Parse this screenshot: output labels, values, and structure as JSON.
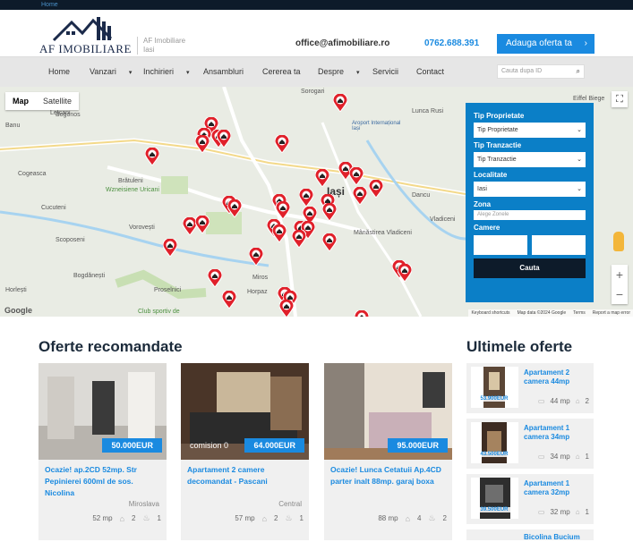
{
  "topbar": {
    "breadcrumb": "Home"
  },
  "header": {
    "logo_text": "AF IMOBILIARE",
    "tagline_line1": "AF Imobiliare",
    "tagline_line2": "Iasi",
    "email": "office@afimobiliare.ro",
    "phone": "0762.688.391",
    "add_offer_label": "Adauga oferta ta"
  },
  "nav": {
    "items": [
      "Home",
      "Vanzari",
      "Inchirieri",
      "Ansambluri",
      "Cererea ta",
      "Despre",
      "Servicii",
      "Contact"
    ],
    "search_placeholder": "Cauta dupa ID"
  },
  "map": {
    "type_map": "Map",
    "type_satellite": "Satellite",
    "google_label": "Google",
    "footer": [
      "Keyboard shortcuts",
      "Map data ©2024 Google",
      "Terms",
      "Report a map error"
    ],
    "places": [
      "Bogonos",
      "Lețcani",
      "Banu",
      "Cogeasca",
      "Brătuleni",
      "Wzneisiene Uricani",
      "Cucuteni",
      "Vorovești",
      "Scoposeni",
      "Bogdănești",
      "Horlești",
      "Valea",
      "Găureni",
      "Miros",
      "Adâncă",
      "Horpaz",
      "Proselnici",
      "Lunca Ce",
      "Sorogari",
      "Aroport Internațional Iași",
      "Lunca Rusi",
      "Dancu",
      "Holboca",
      "Vladiceni",
      "Mânăstirea Vladiceni",
      "Iași",
      "Eiffel Biege",
      "Goada Tisaluti",
      "Ciurea",
      "Club sportiv de"
    ],
    "markers": 42
  },
  "filter": {
    "tip_proprietate_label": "Tip Proprietate",
    "tip_proprietate_value": "Tip Proprietate",
    "tip_tranzactie_label": "Tip Tranzactie",
    "tip_tranzactie_value": "Tip Tranzactie",
    "localitate_label": "Localitate",
    "localitate_value": "Iasi",
    "zona_label": "Zona",
    "zona_placeholder": "Alege Zonele",
    "camere_label": "Camere",
    "search_button": "Cauta"
  },
  "recommended": {
    "heading": "Oferte recomandate",
    "cards": [
      {
        "price": "50.000EUR",
        "commission": "",
        "title": "Ocazie! ap.2CD 52mp. Str Pepinierei 600ml de sos. Nicolina",
        "location": "Miroslava",
        "area": "52 mp",
        "rooms": "2",
        "baths": "1"
      },
      {
        "price": "64.000EUR",
        "commission": "comision 0",
        "title": "Apartament 2 camere decomandat - Pascani",
        "location": "Central",
        "area": "57 mp",
        "rooms": "2",
        "baths": "1"
      },
      {
        "price": "95.000EUR",
        "commission": "",
        "title": "Ocazie! Lunca Cetatuii Ap.4CD parter inalt 88mp. garaj boxa",
        "location": "",
        "area": "88 mp",
        "rooms": "4",
        "baths": "2"
      }
    ]
  },
  "latest": {
    "heading": "Ultimele oferte",
    "items": [
      {
        "title": "Apartament 2 camera 44mp",
        "price": "53.900EUR",
        "area": "44 mp",
        "rooms": "2"
      },
      {
        "title": "Apartament 1 camera 34mp",
        "price": "43.500EUR",
        "area": "34 mp",
        "rooms": "1"
      },
      {
        "title": "Apartament 1 camera 32mp",
        "price": "39.500EUR",
        "area": "32 mp",
        "rooms": "1"
      },
      {
        "title": "Bicolina Bucium",
        "price": "",
        "area": "",
        "rooms": ""
      }
    ]
  },
  "colors": {
    "accent": "#1a8ae0",
    "filter_bg": "#0b7fc7",
    "dark": "#0d1b2a",
    "pin": "#e0202a"
  }
}
